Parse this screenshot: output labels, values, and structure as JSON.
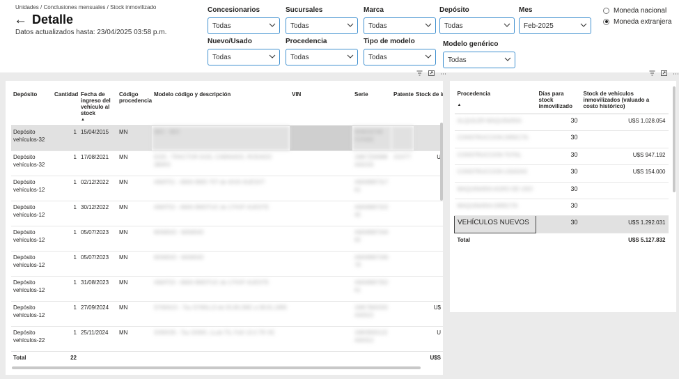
{
  "header": {
    "breadcrumb": "Unidades / Conclusiones mensuales / Stock inmovilizado",
    "title": "Detalle",
    "updated": "Datos actualizados hasta: 23/04/2025 03:58 p.m."
  },
  "filters": {
    "concesionarios": {
      "label": "Concesionarios",
      "value": "Todas"
    },
    "sucursales": {
      "label": "Sucursales",
      "value": "Todas"
    },
    "marca": {
      "label": "Marca",
      "value": "Todas"
    },
    "deposito": {
      "label": "Depósito",
      "value": "Todas"
    },
    "mes": {
      "label": "Mes",
      "value": "Feb-2025"
    },
    "nuevo_usado": {
      "label": "Nuevo/Usado",
      "value": "Todas"
    },
    "procedencia": {
      "label": "Procedencia",
      "value": "Todas"
    },
    "tipo_modelo": {
      "label": "Tipo de modelo",
      "value": "Todas"
    },
    "modelo_generico": {
      "label": "Modelo genérico",
      "value": "Todas"
    }
  },
  "currency": {
    "nacional": "Moneda nacional",
    "extranjera": "Moneda extranjera",
    "selected": "extranjera"
  },
  "left_table": {
    "columns": {
      "deposito": "Depósito",
      "cantidad": "Cantidad",
      "fecha": "Fecha de ingreso del vehículo al stock",
      "codigo": "Código procedencia",
      "modelo": "Modelo código y descripción",
      "vin": "VIN",
      "serie": "Serie",
      "patente": "Patente",
      "stock": "Stock de inmovilizado (valuado histórico)"
    },
    "rows": [
      {
        "deposito": "Depósito vehículos-32",
        "cantidad": "1",
        "fecha": "15/04/2015",
        "codigo": "MN",
        "modelo": "9BX - 9BX",
        "vin": "",
        "serie": "9WBA8768 F0X982",
        "patente": "",
        "stock": ""
      },
      {
        "deposito": "Depósito vehículos-32",
        "cantidad": "1",
        "fecha": "17/08/2021",
        "codigo": "MN",
        "modelo": "6155 - TRACTOR 6155, CABINADO, RODADO 380R3",
        "vin": "",
        "serie": "1MK7200988 A00155",
        "patente": "XXXT7",
        "stock": "U"
      },
      {
        "deposito": "Depósito vehículos-12",
        "cantidad": "1",
        "fecha": "02/12/2022",
        "codigo": "MN",
        "modelo": "AMAT51 - AMAI 8WD 75T de 4X4X AUESXT",
        "vin": "",
        "serie": "AMA8987317 61",
        "patente": "",
        "stock": ""
      },
      {
        "deposito": "Depósito vehículos-12",
        "cantidad": "1",
        "fecha": "30/12/2022",
        "codigo": "MN",
        "modelo": "AMAT52 - AMAI 8WDTUC de 17HVF AUESTE",
        "vin": "",
        "serie": "AMA8987322 45",
        "patente": "",
        "stock": ""
      },
      {
        "deposito": "Depósito vehículos-12",
        "cantidad": "1",
        "fecha": "05/07/2023",
        "codigo": "MN",
        "modelo": "MAM043 - MAM043",
        "vin": "",
        "serie": "AMA8987344 92",
        "patente": "",
        "stock": ""
      },
      {
        "deposito": "Depósito vehículos-12",
        "cantidad": "1",
        "fecha": "05/07/2023",
        "codigo": "MN",
        "modelo": "MAM043 - MAM043",
        "vin": "",
        "serie": "AMA8987346 78",
        "patente": "",
        "stock": ""
      },
      {
        "deposito": "Depósito vehículos-12",
        "cantidad": "1",
        "fecha": "31/08/2023",
        "codigo": "MN",
        "modelo": "AMAT53 - AMAI 8WDTUC de 17HVF AUESTE",
        "vin": "",
        "serie": "AMA8987352 61",
        "patente": "",
        "stock": ""
      },
      {
        "deposito": "Depósito vehículos-12",
        "cantidad": "1",
        "fecha": "27/09/2024",
        "codigo": "MN",
        "modelo": "SYMAGX - Tsu SYMILLS de 55.80.2MC a 38.91.1895",
        "vin": "",
        "serie": "1MK7800333 A00522",
        "patente": "",
        "stock": "U$"
      },
      {
        "deposito": "Depósito vehículos-22",
        "cantidad": "1",
        "fecha": "25/11/2024",
        "codigo": "MN",
        "modelo": "SXMX35 - Tsu SXMX, LLub TS, FoD 13.5 TR XE",
        "vin": "",
        "serie": "1MK9900122 A00312",
        "patente": "",
        "stock": "U"
      }
    ],
    "total_label": "Total",
    "total_cantidad": "22",
    "total_stock": "U$S"
  },
  "right_table": {
    "columns": {
      "procedencia": "Procedencia",
      "dias": "Días para stock inmovilizado",
      "stock": "Stock de vehículos inmovilizados (valuado a costo histórico)"
    },
    "rows": [
      {
        "procedencia": "ALQUILER MAQUINARIA",
        "dias": "30",
        "stock": "U$S 1.028.054"
      },
      {
        "procedencia": "CONSTRUCCION DIRECTA",
        "dias": "30",
        "stock": ""
      },
      {
        "procedencia": "CONSTRUCCION TOTAL",
        "dias": "30",
        "stock": "U$S 947.192"
      },
      {
        "procedencia": "CONSTRUCCION USADAS",
        "dias": "30",
        "stock": "U$S 154.000"
      },
      {
        "procedencia": "MAQUINARIA AGRO DE USO",
        "dias": "30",
        "stock": ""
      },
      {
        "procedencia": "MAQUINARIA DIRECTA",
        "dias": "30",
        "stock": ""
      },
      {
        "procedencia": "VEHÍCULOS NUEVOS",
        "dias": "30",
        "stock": "U$S 1.292.031"
      }
    ],
    "total_label": "Total",
    "total_stock": "U$S 5.127.832"
  },
  "icons": {
    "back": "back-arrow-icon",
    "filter": "filter-icon",
    "focus": "focus-mode-icon",
    "more": "more-options-icon"
  }
}
